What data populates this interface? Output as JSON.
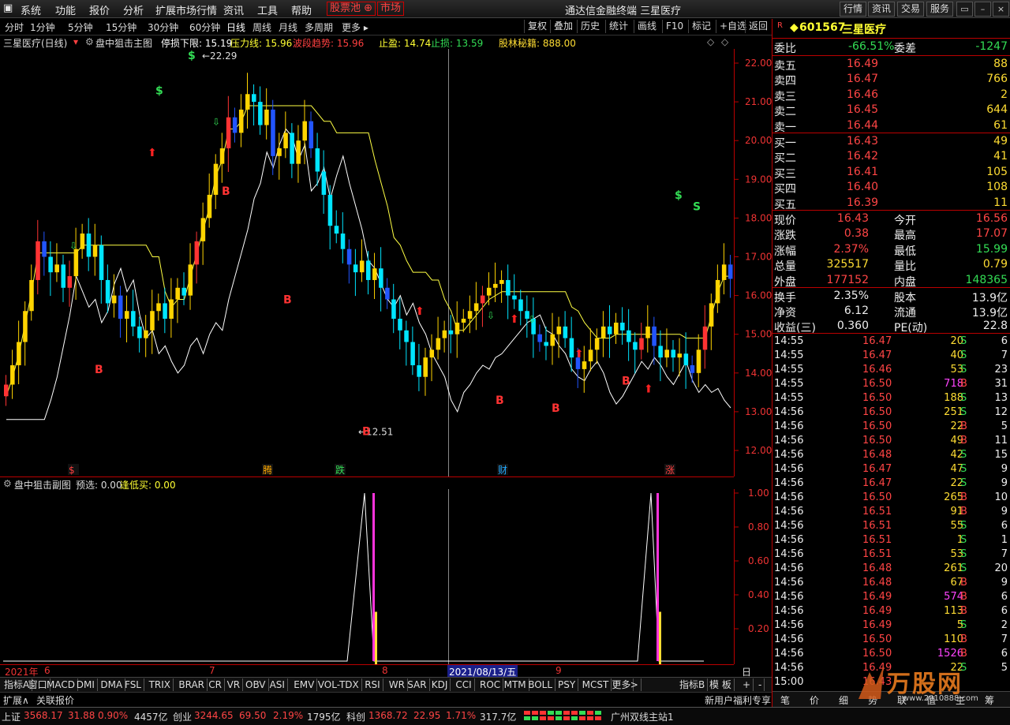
{
  "menu": [
    "系统",
    "功能",
    "报价",
    "分析",
    "扩展市场行情",
    "资讯",
    "工具",
    "帮助"
  ],
  "menu_special": [
    "股票池",
    "市场"
  ],
  "app_title": "通达信金融终端  三星医疗",
  "right_buttons": [
    "行情",
    "资讯",
    "交易",
    "服务"
  ],
  "periods": [
    "分时",
    "1分钟",
    "5分钟",
    "15分钟",
    "30分钟",
    "60分钟",
    "日线",
    "周线",
    "月线",
    "多周期",
    "更多"
  ],
  "active_period": "日线",
  "toolbar": [
    "复权",
    "叠加",
    "历史",
    "统计",
    "画线",
    "F10",
    "标记",
    "+自选",
    "返回"
  ],
  "info": {
    "stock": "三星医疗(日线)",
    "indicator": "盘中狙击主图",
    "stop_low": "停损下限: 15.19",
    "pressure": "压力线: 15.96",
    "wave": "波段趋势: 15.96",
    "take_profit": "止盈: 14.74",
    "stop_loss": "止损: 13.59",
    "bollin": "股林秘籍: 888.00"
  },
  "price_axis": [
    "22.00",
    "21.00",
    "20.00",
    "19.00",
    "18.00",
    "17.00",
    "16.00",
    "15.00",
    "14.00",
    "13.00",
    "12.00"
  ],
  "price_labels": {
    "high": "22.29",
    "low": "12.51"
  },
  "event_marks": [
    "$",
    "腾",
    "跌",
    "财",
    "涨"
  ],
  "sub_header": {
    "name": "盘中狙击副图",
    "pre": "预选: 0.00",
    "buy": "逢低买: 0.00"
  },
  "sub_axis": [
    "1.00",
    "0.80",
    "0.60",
    "0.40",
    "0.20"
  ],
  "date_axis": {
    "year": "2021年",
    "m6": "6",
    "m7": "7",
    "m8": "8",
    "cursor": "2021/08/13/五",
    "m9": "9",
    "period": "日线"
  },
  "indicator_tabs": [
    "指标A",
    "窗口",
    "MACD",
    "DMI",
    "DMA",
    "FSL",
    "TRIX",
    "BRAR",
    "CR",
    "VR",
    "OBV",
    "ASI",
    "EMV",
    "VOL-TDX",
    "RSI",
    "WR",
    "SAR",
    "KDJ",
    "CCI",
    "ROC",
    "MTM",
    "BOLL",
    "PSY",
    "MCST",
    "更多",
    ">"
  ],
  "indicator_tabs_right": [
    "指标B",
    "模 板",
    "+",
    "-"
  ],
  "tabs2": [
    "扩展∧",
    "关联报价"
  ],
  "tabs2_right": "新用户福利专享",
  "quote": {
    "code": "601567",
    "name": "三星医疗",
    "webi_label": "委比",
    "webi": "-66.51%",
    "weicha_label": "委差",
    "weicha": "-1247",
    "sell": [
      {
        "label": "卖五",
        "price": "16.49",
        "vol": "88"
      },
      {
        "label": "卖四",
        "price": "16.47",
        "vol": "766"
      },
      {
        "label": "卖三",
        "price": "16.46",
        "vol": "2"
      },
      {
        "label": "卖二",
        "price": "16.45",
        "vol": "644"
      },
      {
        "label": "卖一",
        "price": "16.44",
        "vol": "61"
      }
    ],
    "buy": [
      {
        "label": "买一",
        "price": "16.43",
        "vol": "49"
      },
      {
        "label": "买二",
        "price": "16.42",
        "vol": "41"
      },
      {
        "label": "买三",
        "price": "16.41",
        "vol": "105"
      },
      {
        "label": "买四",
        "price": "16.40",
        "vol": "108"
      },
      {
        "label": "买五",
        "price": "16.39",
        "vol": "11"
      }
    ],
    "stats": [
      {
        "l1": "现价",
        "v1": "16.43",
        "c1": "red",
        "l2": "今开",
        "v2": "16.56",
        "c2": "red"
      },
      {
        "l1": "涨跌",
        "v1": "0.38",
        "c1": "red",
        "l2": "最高",
        "v2": "17.07",
        "c2": "red"
      },
      {
        "l1": "涨幅",
        "v1": "2.37%",
        "c1": "red",
        "l2": "最低",
        "v2": "15.99",
        "c2": "grn"
      },
      {
        "l1": "总量",
        "v1": "325517",
        "c1": "yel",
        "l2": "量比",
        "v2": "0.79",
        "c2": "yel"
      },
      {
        "l1": "外盘",
        "v1": "177152",
        "c1": "red",
        "l2": "内盘",
        "v2": "148365",
        "c2": "grn"
      }
    ],
    "stats2": [
      {
        "l1": "换手",
        "v1": "2.35%",
        "l2": "股本",
        "v2": "13.9亿"
      },
      {
        "l1": "净资",
        "v1": "6.12",
        "l2": "流通",
        "v2": "13.9亿"
      },
      {
        "l1": "收益(三)",
        "v1": "0.360",
        "l2": "PE(动)",
        "v2": "22.8"
      }
    ]
  },
  "ticks": [
    [
      "14:55",
      "16.47",
      "20",
      "S",
      "6"
    ],
    [
      "14:55",
      "16.47",
      "40",
      "S",
      "7"
    ],
    [
      "14:55",
      "16.46",
      "53",
      "S",
      "23"
    ],
    [
      "14:55",
      "16.50",
      "718",
      "B",
      "31"
    ],
    [
      "14:55",
      "16.50",
      "188",
      "S",
      "13"
    ],
    [
      "14:56",
      "16.50",
      "251",
      "S",
      "12"
    ],
    [
      "14:56",
      "16.50",
      "22",
      "B",
      "5"
    ],
    [
      "14:56",
      "16.50",
      "49",
      "B",
      "11"
    ],
    [
      "14:56",
      "16.48",
      "42",
      "S",
      "15"
    ],
    [
      "14:56",
      "16.47",
      "47",
      "S",
      "9"
    ],
    [
      "14:56",
      "16.47",
      "22",
      "S",
      "9"
    ],
    [
      "14:56",
      "16.50",
      "265",
      "B",
      "10"
    ],
    [
      "14:56",
      "16.51",
      "91",
      "B",
      "9"
    ],
    [
      "14:56",
      "16.51",
      "55",
      "S",
      "6"
    ],
    [
      "14:56",
      "16.51",
      "1",
      "S",
      "1"
    ],
    [
      "14:56",
      "16.51",
      "53",
      "S",
      "7"
    ],
    [
      "14:56",
      "16.48",
      "261",
      "S",
      "20"
    ],
    [
      "14:56",
      "16.48",
      "67",
      "B",
      "9"
    ],
    [
      "14:56",
      "16.49",
      "574",
      "B",
      "6"
    ],
    [
      "14:56",
      "16.49",
      "113",
      "B",
      "6"
    ],
    [
      "14:56",
      "16.49",
      "5",
      "S",
      "2"
    ],
    [
      "14:56",
      "16.50",
      "110",
      "B",
      "7"
    ],
    [
      "14:56",
      "16.50",
      "1526",
      "B",
      "6"
    ],
    [
      "14:56",
      "16.49",
      "22",
      "S",
      "5"
    ],
    [
      "15:00",
      "16.43",
      "",
      "",
      ""
    ]
  ],
  "right_tabs": [
    "笔",
    "价",
    "细",
    "势",
    "联",
    "值",
    "主",
    "筹"
  ],
  "status": {
    "sh_label": "上证",
    "sh": "3568.17",
    "sh_chg": "31.88",
    "sh_pct": "0.90%",
    "sh_amt": "4457亿",
    "cy_label": "创业",
    "cy": "3244.65",
    "cy_chg": "69.50",
    "cy_pct": "2.19%",
    "cy_amt": "1795亿",
    "kc_label": "科创",
    "kc": "1368.72",
    "kc_chg": "22.95",
    "kc_pct": "1.71%",
    "kc_amt": "317.7亿",
    "server": "广州双线主站1"
  },
  "watermark": "万股网",
  "watermark_url": "www.2010888.com"
}
